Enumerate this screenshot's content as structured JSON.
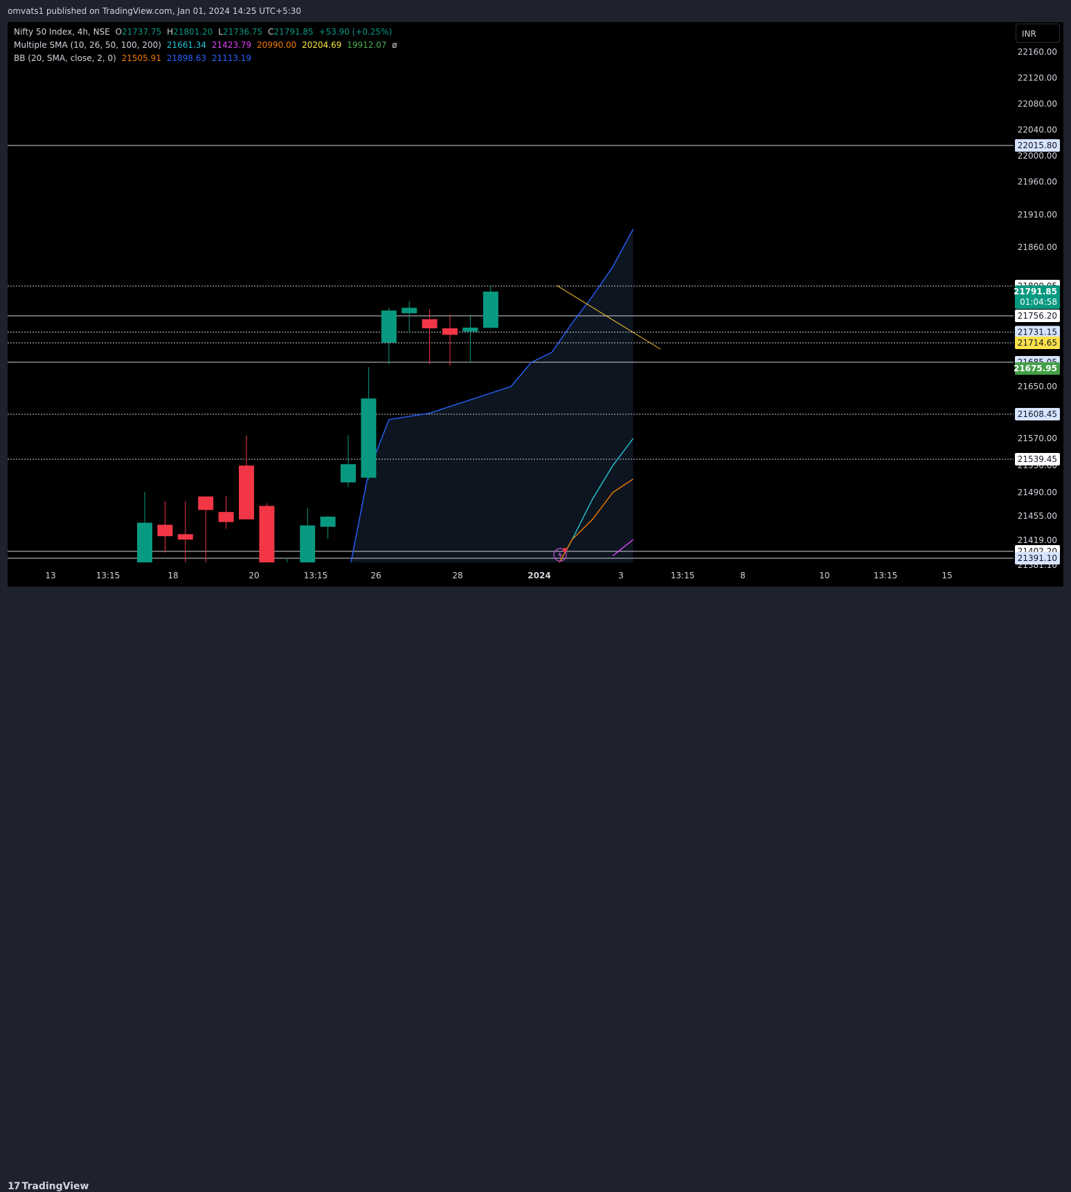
{
  "header": {
    "published_text": "omvats1 published on TradingView.com, Jan 01, 2024 14:25 UTC+5:30"
  },
  "legend": {
    "symbol": "Nifty 50 Index, 4h, NSE",
    "open_label": "O",
    "open": "21737.75",
    "high_label": "H",
    "high": "21801.20",
    "low_label": "L",
    "low": "21736.75",
    "close_label": "C",
    "close": "21791.85",
    "change": "+53.90 (+0.25%)",
    "sma_title": "Multiple SMA (10, 26, 50, 100, 200)",
    "sma_values": [
      "21661.34",
      "21423.79",
      "20990.00",
      "20204.69",
      "19912.07",
      "ø"
    ],
    "bb_title": "BB (20, SMA, close, 2, 0)",
    "bb_values": [
      "21505.91",
      "21898.63",
      "21113.19"
    ]
  },
  "currency_label": "INR",
  "footer": {
    "brand": "TradingView",
    "brand_mark": "17"
  },
  "colors": {
    "up": "#089981",
    "down": "#f23645",
    "bb_upper": "#2962ff",
    "sma10": "#26c6da",
    "sma50": "#f57c00",
    "sma26": "#e040fb",
    "yellow": "#fbc02d",
    "green_label": "#43a047"
  },
  "chart_data": {
    "type": "candlestick",
    "symbol": "Nifty 50 Index",
    "timeframe": "4h",
    "y_range": [
      21381.1,
      22174.0
    ],
    "y_tick_labels": [
      "22160.00",
      "22120.00",
      "22080.00",
      "22040.00",
      "22000.00",
      "21960.00",
      "21910.00",
      "21860.00",
      "21800.00",
      "21756.00",
      "21714.00",
      "21650.00",
      "21570.00",
      "21530.00",
      "21490.00",
      "21455.00",
      "21419.00",
      "21381.10"
    ],
    "x_tick_labels": [
      "13",
      "13:15",
      "18",
      "20",
      "13:15",
      "26",
      "28",
      "2024",
      "3",
      "13:15",
      "8",
      "10",
      "13:15",
      "15"
    ],
    "candles": [
      {
        "x": "18",
        "o": 21381,
        "h": 21491,
        "l": 21381,
        "c": 21445
      },
      {
        "x": "18",
        "o": 21442,
        "h": 21477,
        "l": 21400,
        "c": 21425
      },
      {
        "x": "18",
        "o": 21428,
        "h": 21477,
        "l": 21380,
        "c": 21420
      },
      {
        "x": "19",
        "o": 21484,
        "h": 21484,
        "l": 21380,
        "c": 21464
      },
      {
        "x": "19",
        "o": 21461,
        "h": 21485,
        "l": 21436,
        "c": 21446
      },
      {
        "x": "20",
        "o": 21530,
        "h": 21575,
        "l": 21465,
        "c": 21450
      },
      {
        "x": "20",
        "o": 21470,
        "h": 21474,
        "l": 21300,
        "c": 21330
      },
      {
        "x": "21",
        "o": 21360,
        "h": 21390,
        "l": 21330,
        "c": 21380
      },
      {
        "x": "26",
        "o": 21381,
        "h": 21467,
        "l": 21381,
        "c": 21441
      },
      {
        "x": "26",
        "o": 21439,
        "h": 21455,
        "l": 21421,
        "c": 21454
      },
      {
        "x": "27",
        "o": 21505,
        "h": 21575,
        "l": 21498,
        "c": 21532
      },
      {
        "x": "27",
        "o": 21512,
        "h": 21678,
        "l": 21509,
        "c": 21632
      },
      {
        "x": "28",
        "o": 21715,
        "h": 21768,
        "l": 21682,
        "c": 21764
      },
      {
        "x": "28",
        "o": 21760,
        "h": 21778,
        "l": 21731,
        "c": 21768
      },
      {
        "x": "29",
        "o": 21751,
        "h": 21766,
        "l": 21682,
        "c": 21737
      },
      {
        "x": "29",
        "o": 21737,
        "h": 21758,
        "l": 21680,
        "c": 21727
      },
      {
        "x": "2024",
        "o": 21732,
        "h": 21758,
        "l": 21685,
        "c": 21738
      },
      {
        "x": "2024",
        "o": 21737.75,
        "h": 21801.2,
        "l": 21736.75,
        "c": 21791.85
      }
    ],
    "horizontal_levels": [
      {
        "value": 22015.8,
        "label": "22015.80",
        "style": "solid",
        "badge": "#d6e4ff"
      },
      {
        "value": 21800.05,
        "label": "21800.05",
        "style": "dotted",
        "badge": "#ffffff"
      },
      {
        "value": 21756.2,
        "label": "21756.20",
        "style": "solid",
        "badge": "#ffffff"
      },
      {
        "value": 21731.15,
        "label": "21731.15",
        "style": "dotted",
        "badge": "#d6e4ff"
      },
      {
        "value": 21714.65,
        "label": "21714.65",
        "style": "dotted",
        "badge": "#fbe14a"
      },
      {
        "value": 21685.05,
        "label": "21685.05",
        "style": "solid",
        "badge": "#d6e4ff"
      },
      {
        "value": 21675.95,
        "label": "21675.95",
        "style": "none",
        "badge": "#43a047"
      },
      {
        "value": 21608.45,
        "label": "21608.45",
        "style": "dotted",
        "badge": "#d6e4ff"
      },
      {
        "value": 21539.45,
        "label": "21539.45",
        "style": "dotted",
        "badge": "#ffffff"
      },
      {
        "value": 21402.2,
        "label": "21402.20",
        "style": "solid",
        "badge": "#ffffff"
      },
      {
        "value": 21391.1,
        "label": "21391.10",
        "style": "solid",
        "badge": "#d6e4ff"
      }
    ],
    "last_price": {
      "value": 21791.85,
      "label": "21791.85",
      "countdown": "01:04:58"
    },
    "bb_upper": [
      [
        18,
        21360
      ],
      [
        19,
        21520
      ],
      [
        20,
        21600
      ],
      [
        22,
        21610
      ],
      [
        25,
        21640
      ],
      [
        26,
        21650
      ],
      [
        27,
        21685
      ],
      [
        28,
        21700
      ],
      [
        29,
        21745
      ],
      [
        30,
        21785
      ],
      [
        31,
        21830
      ],
      [
        32,
        21888
      ]
    ],
    "sma10": [
      [
        27,
        21300
      ],
      [
        28,
        21360
      ],
      [
        29,
        21420
      ],
      [
        30,
        21480
      ],
      [
        31,
        21530
      ],
      [
        32,
        21570
      ]
    ],
    "sma26": [
      [
        31,
        21395
      ],
      [
        32,
        21420
      ]
    ],
    "sma50": [
      [
        28,
        21380
      ],
      [
        29,
        21420
      ],
      [
        30,
        21450
      ],
      [
        31,
        21490
      ],
      [
        32,
        21510
      ]
    ],
    "trendline": {
      "from": [
        28,
        21801
      ],
      "to": [
        33,
        21705
      ]
    }
  }
}
